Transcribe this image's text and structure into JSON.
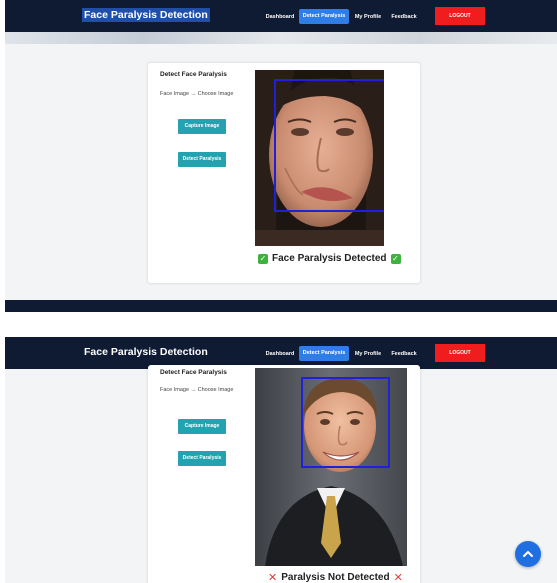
{
  "screens": [
    {
      "brand": "Face Paralysis Detection",
      "nav": [
        "Dashboard",
        "Detect Paralysis",
        "My Profile",
        "Feedback"
      ],
      "active_nav": 1,
      "logout": "LOGOUT",
      "card_title": "Detect Face Paralysis",
      "face_label": "Face Image",
      "arrow": "→",
      "choose_label": "Choose Image",
      "capture_btn": "Capture Image",
      "detect_btn": "Detect Paralysis",
      "result": "Face Paralysis Detected"
    },
    {
      "brand": "Face Paralysis Detection",
      "nav": [
        "Dashboard",
        "Detect Paralysis",
        "My Profile",
        "Feedback"
      ],
      "active_nav": 1,
      "logout": "LOGOUT",
      "card_title": "Detect Face Paralysis",
      "face_label": "Face Image",
      "arrow": "→",
      "choose_label": "Choose Image",
      "capture_btn": "Capture Image",
      "detect_btn": "Detect Paralysis",
      "result": "Paralysis Not Detected"
    }
  ],
  "icons": {
    "result_positive": "check-square-icon",
    "result_negative": "x-mark-icon",
    "scroll_top": "chevron-up-icon"
  },
  "colors": {
    "navbar": "#0f1a33",
    "active_tab": "#2f7de6",
    "logout": "#ef1d1d",
    "teal_button": "#23a3b0",
    "detection_box": "#2020d8",
    "success": "#3db33d",
    "fail": "#e23b3b",
    "fab": "#1f6fe0"
  }
}
